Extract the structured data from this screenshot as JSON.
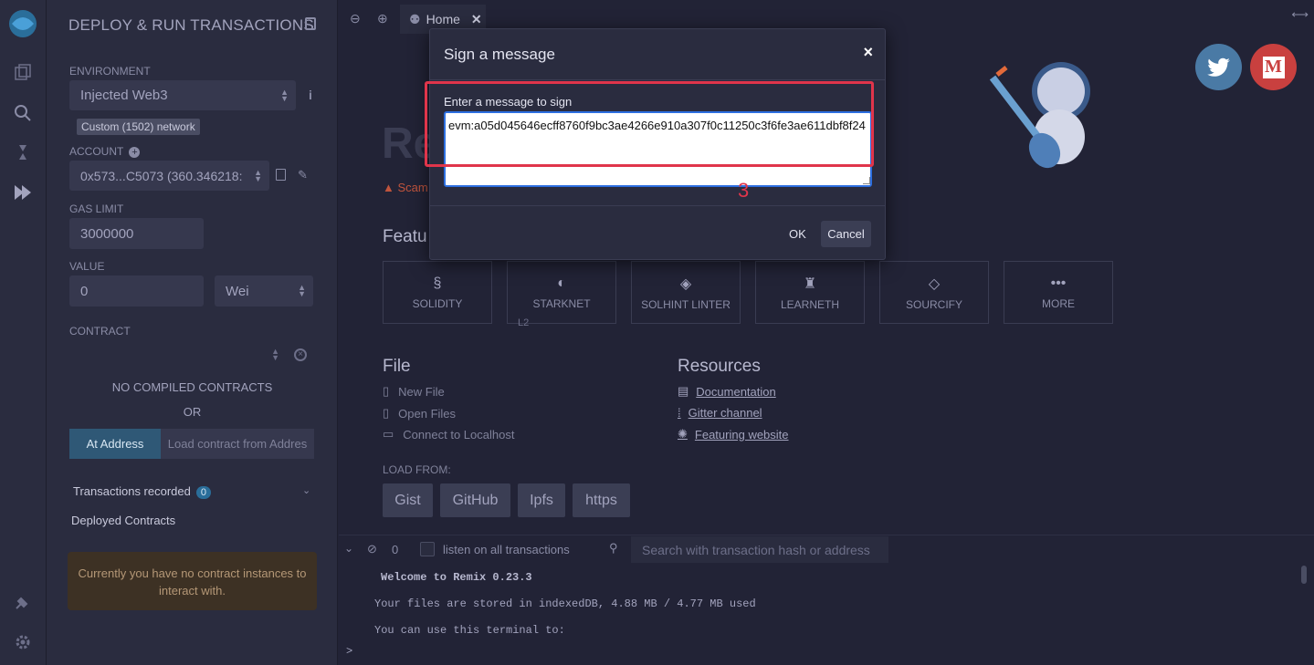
{
  "sidebar": {
    "title": "DEPLOY & RUN TRANSACTIONS",
    "environment_label": "ENVIRONMENT",
    "environment_value": "Injected Web3",
    "network_badge": "Custom (1502) network",
    "account_label": "ACCOUNT",
    "account_value": "0x573...C5073 (360.346218:",
    "gas_limit_label": "GAS LIMIT",
    "gas_limit_value": "3000000",
    "value_label": "VALUE",
    "value_value": "0",
    "value_unit": "Wei",
    "contract_label": "CONTRACT",
    "no_contracts": "NO COMPILED CONTRACTS",
    "or": "OR",
    "at_address": "At Address",
    "load_contract": "Load contract from Addres",
    "transactions_recorded": "Transactions recorded",
    "transactions_count": "0",
    "deployed_contracts": "Deployed Contracts",
    "no_instances": "Currently you have no contract instances to interact with."
  },
  "tabs": {
    "home": "Home"
  },
  "home": {
    "title_fragment": "Re",
    "scam_fragment": "Scam",
    "featured_fragment": "Featu",
    "features": [
      {
        "label": "SOLIDITY",
        "icon": "solidity-icon"
      },
      {
        "label": "STARKNET",
        "icon": "starknet-icon"
      },
      {
        "label": "SOLHINT LINTER",
        "icon": "solhint-icon"
      },
      {
        "label": "LEARNETH",
        "icon": "learneth-icon"
      },
      {
        "label": "SOURCIFY",
        "icon": "sourcify-icon"
      },
      {
        "label": "MORE",
        "icon": "more-icon"
      }
    ],
    "l2_label": "L2",
    "file_heading": "File",
    "file_links": [
      "New File",
      "Open Files",
      "Connect to Localhost"
    ],
    "resources_heading": "Resources",
    "resource_links": [
      "Documentation",
      "Gitter channel",
      "Featuring website"
    ],
    "load_from_label": "LOAD FROM:",
    "load_buttons": [
      "Gist",
      "GitHub",
      "Ipfs",
      "https"
    ]
  },
  "terminal": {
    "count": "0",
    "listen_label": "listen on all transactions",
    "search_placeholder": "Search with transaction hash or address",
    "lines": [
      "Welcome to Remix 0.23.3",
      "Your files are stored in indexedDB, 4.88 MB / 4.77 MB used",
      "You can use this terminal to:"
    ],
    "prompt": ">"
  },
  "modal": {
    "title": "Sign a message",
    "close": "×",
    "label": "Enter a message to sign",
    "message": "evm:a05d045646ecff8760f9bc3ae4266e910a307f0c11250c3f6fe3ae611dbf8f24",
    "ok": "OK",
    "cancel": "Cancel",
    "annotation": "3"
  },
  "colors": {
    "accent_red": "#e0354b",
    "focus_blue": "#2d6fe0",
    "twitter": "#4a7aa5",
    "medium": "#c9403f"
  }
}
